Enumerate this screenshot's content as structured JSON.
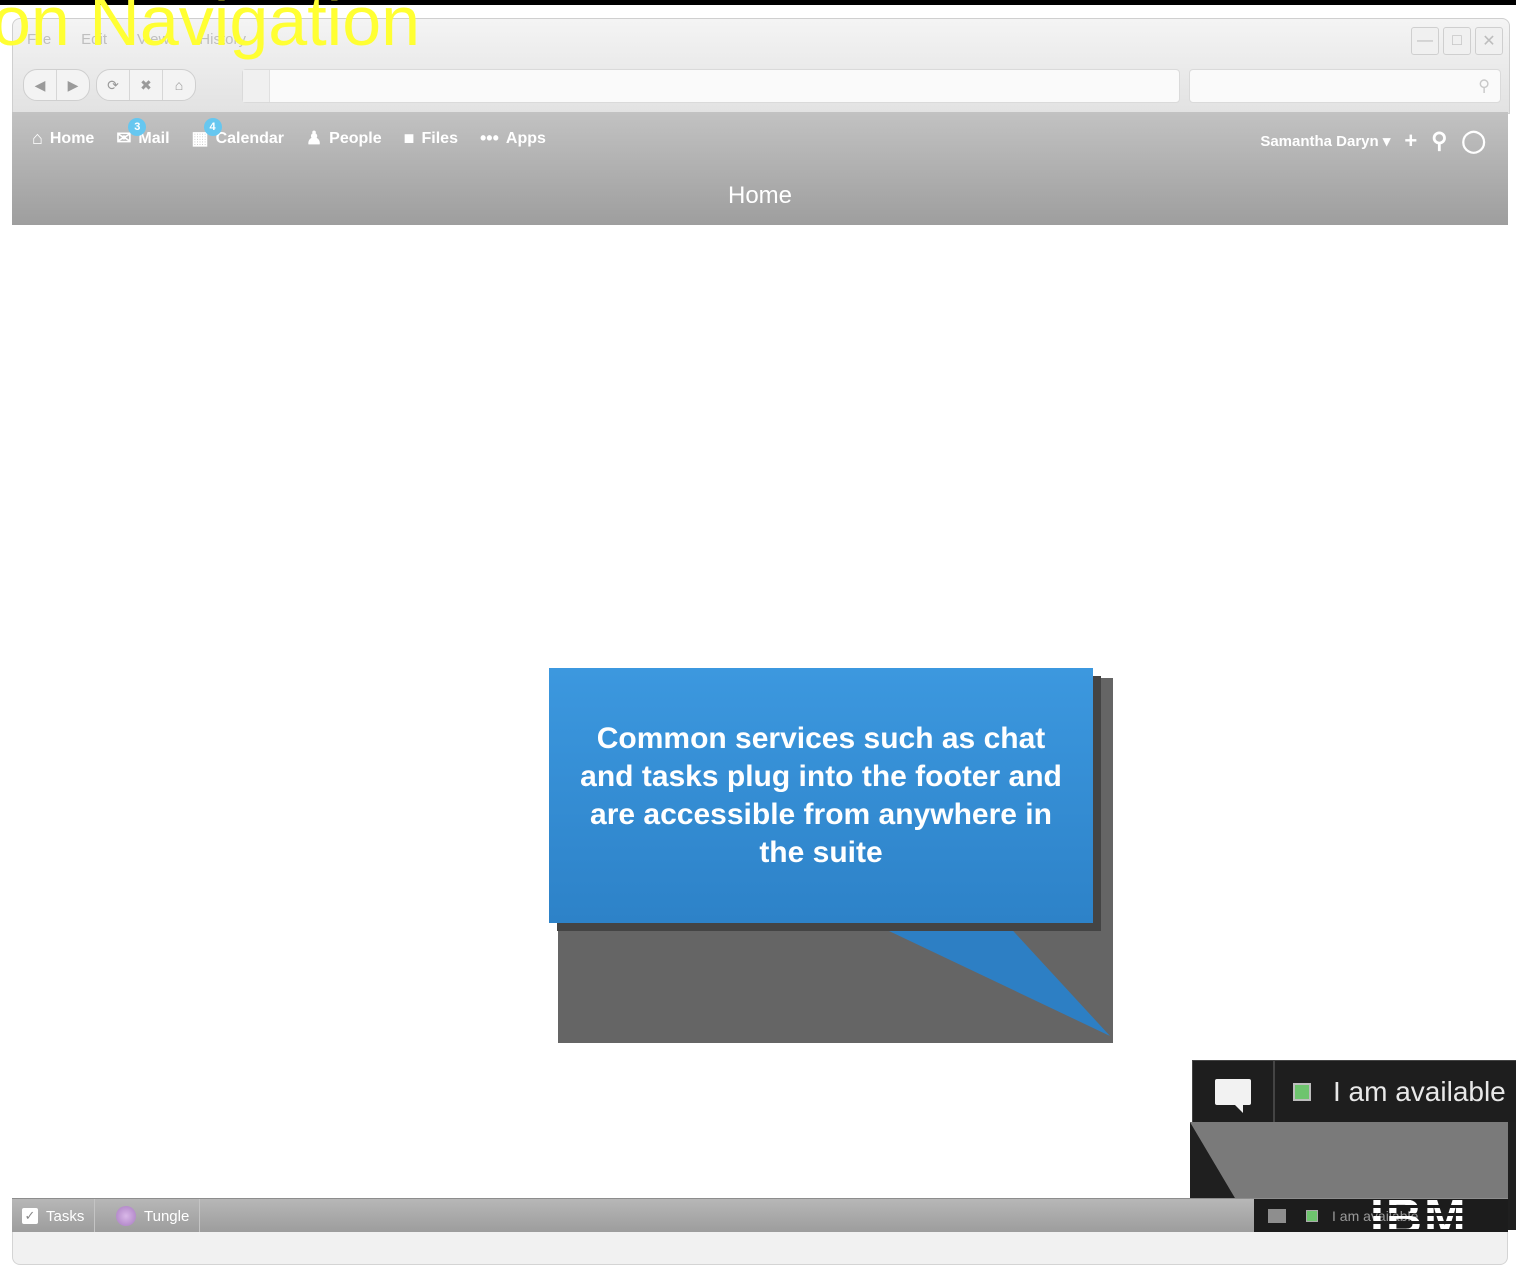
{
  "slide_title": "on Navigation",
  "browser": {
    "menu": [
      "File",
      "Edit",
      "View",
      "History"
    ],
    "window_controls": [
      "minimize-icon",
      "maximize-icon",
      "close-icon"
    ],
    "nav_buttons": [
      "back-icon",
      "forward-icon",
      "reload-icon",
      "stop-icon",
      "home-icon"
    ],
    "address_value": "",
    "search_value": ""
  },
  "app": {
    "nav": [
      {
        "label": "Home",
        "icon": "home-icon",
        "badge": ""
      },
      {
        "label": "Mail",
        "icon": "mail-icon",
        "badge": "3"
      },
      {
        "label": "Calendar",
        "icon": "calendar-icon",
        "badge": "4"
      },
      {
        "label": "People",
        "icon": "people-icon",
        "badge": ""
      },
      {
        "label": "Files",
        "icon": "folder-icon",
        "badge": ""
      },
      {
        "label": "Apps",
        "icon": "more-icon",
        "badge": ""
      }
    ],
    "user": "Samantha Daryn",
    "page_title": "Home"
  },
  "callout": {
    "text": "Common services such as chat and tasks plug into the footer and are accessible from anywhere in the suite",
    "color": "#3a94dc"
  },
  "chat": {
    "status": "I am available",
    "status_color": "#6ec46e"
  },
  "footer": {
    "items": [
      {
        "label": "Tasks",
        "icon": "checkbox-icon"
      },
      {
        "label": "Tungle",
        "icon": "tungle-icon"
      }
    ],
    "status": "I am available"
  },
  "logo": "IBM"
}
